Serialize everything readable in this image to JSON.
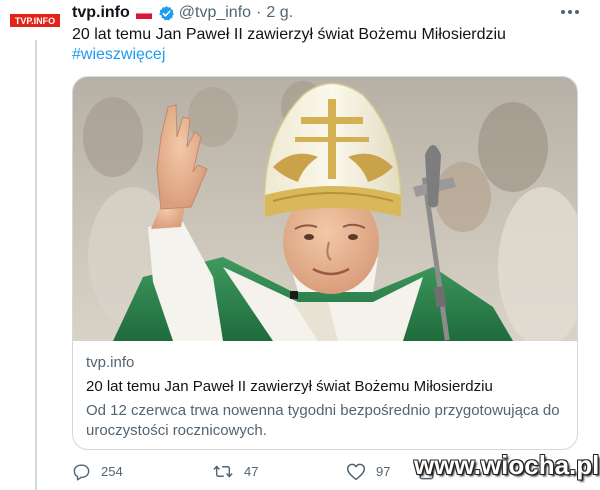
{
  "author": {
    "avatar_logo_text": "TVP.INFO",
    "display_name": "tvp.info",
    "flag_icon": "poland-flag-icon",
    "verified_icon": "verified-badge-icon",
    "handle": "@tvp_info",
    "separator": "·",
    "time": "2 g."
  },
  "tweet": {
    "text": "20 lat temu Jan Paweł II zawierzył świat Bożemu Miłosierdziu",
    "hashtag": "#wieszwięcej"
  },
  "card": {
    "image_icon": "photo",
    "domain": "tvp.info",
    "title": "20 lat temu Jan Paweł II zawierzył świat Bożemu Miłosierdziu",
    "description": "Od 12 czerwca trwa nowenna tygodni bezpośrednio przygotowująca do uroczystości rocznicowych."
  },
  "actions": {
    "reply_count": "254",
    "retweet_count": "47",
    "like_count": "97"
  },
  "watermark": "www.wiocha.pl",
  "colors": {
    "link": "#1d9bf0",
    "secondary_text": "#536471",
    "border": "#cfd9de",
    "logo_red": "#e2231a"
  }
}
